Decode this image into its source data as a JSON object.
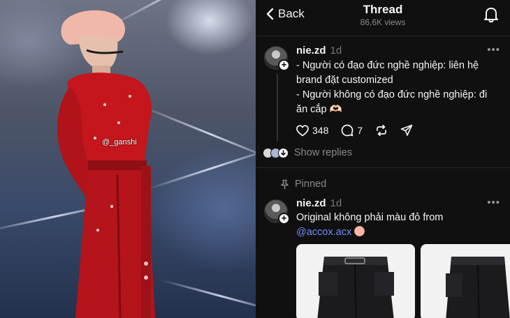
{
  "photo": {
    "watermark": "@_ganshi"
  },
  "header": {
    "back_label": "Back",
    "title": "Thread",
    "views": "86,6K views"
  },
  "post": {
    "username": "nie.zd",
    "time": "1d",
    "lines": [
      "- Người có đạo đức nghề nghiệp: liên hệ",
      "brand đặt customized",
      "- Người không có đạo đức nghề nghiệp: đi",
      "ăn cắp 🫶🏻"
    ],
    "likes": "348",
    "comments": "7"
  },
  "replies": {
    "label": "Show replies"
  },
  "pinned": {
    "label": "Pinned",
    "username": "nie.zd",
    "time": "1d",
    "text": "Original không phải màu đỏ from",
    "mention": "@accox.acx"
  },
  "colors": {
    "accent_link": "#6f8dff",
    "background": "#101010",
    "costume": "#c4161c"
  },
  "icons": [
    "chevron-left-icon",
    "bell-icon",
    "heart-icon",
    "comment-icon",
    "repost-icon",
    "send-icon",
    "pin-icon",
    "more-icon",
    "follow-plus-icon"
  ]
}
